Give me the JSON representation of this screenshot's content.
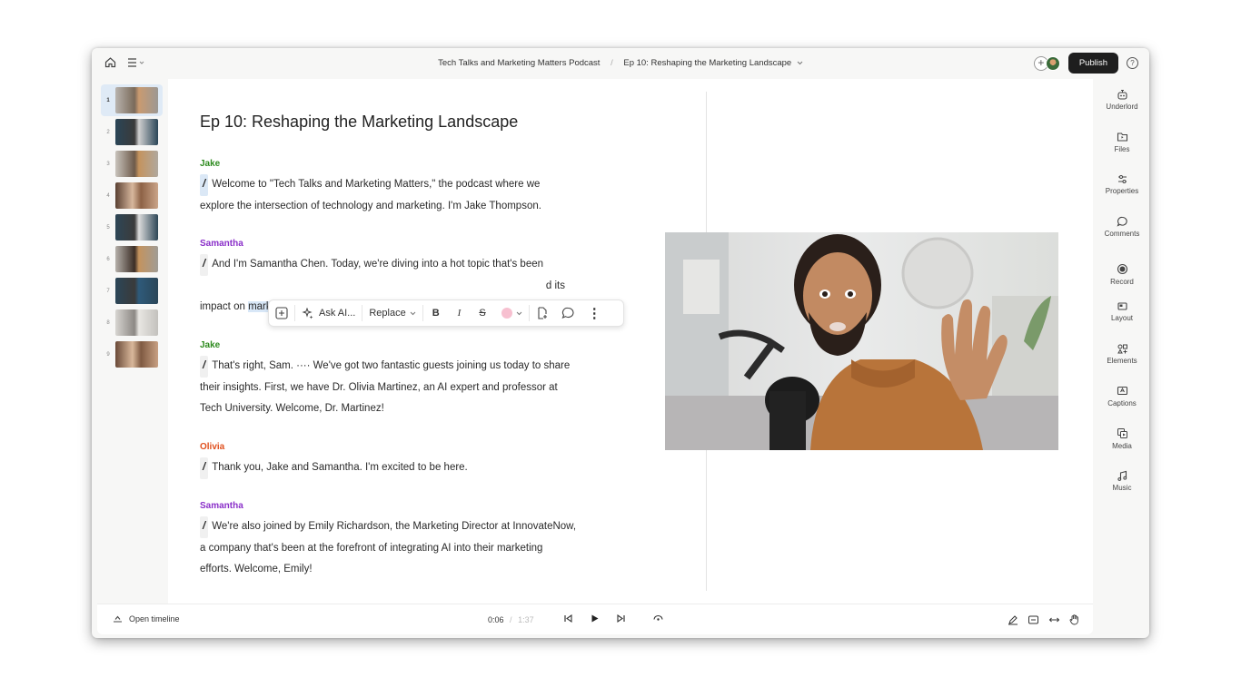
{
  "topbar": {
    "project": "Tech Talks and Marketing Matters Podcast",
    "separator": "/",
    "episode": "Ep 10: Reshaping the Marketing Landscape",
    "publish_label": "Publish",
    "add_label": "+",
    "help_label": "?"
  },
  "thumbnails": [
    {
      "num": "1",
      "bg": "#8f8a86"
    },
    {
      "num": "2",
      "bg": "#2f4a5c"
    },
    {
      "num": "3",
      "bg": "#a79c90"
    },
    {
      "num": "4",
      "bg": "#8c6a58"
    },
    {
      "num": "5",
      "bg": "#2d4656"
    },
    {
      "num": "6",
      "bg": "#9d9890"
    },
    {
      "num": "7",
      "bg": "#2b4658"
    },
    {
      "num": "8",
      "bg": "#c3c1bd"
    },
    {
      "num": "9",
      "bg": "#8b6853"
    }
  ],
  "document": {
    "title": "Ep 10: Reshaping the Marketing Landscape",
    "blocks": [
      {
        "speaker": "Jake",
        "color": "#2e8b1f",
        "text_lines": [
          "Welcome to \"Tech Talks and Marketing Matters,\" the podcast where we",
          "explore the intersection of technology and marketing. I'm Jake Thompson."
        ]
      },
      {
        "speaker": "Samantha",
        "color": "#8a2fc9",
        "line1": "And I'm Samantha Chen. Today, we're diving into a hot topic that's been",
        "line2_tail": "d its",
        "line3_pre": "impact on ",
        "line3_hl": "marketing strategies."
      },
      {
        "speaker": "Jake",
        "color": "#2e8b1f",
        "text_lines": [
          "That's right, Sam. ···· We've got two fantastic guests joining us today to share",
          "their insights. First, we have Dr. Olivia Martinez, an AI expert and professor at",
          "Tech University. Welcome, Dr. Martinez!"
        ]
      },
      {
        "speaker": "Olivia",
        "color": "#e0501e",
        "text_lines": [
          "Thank you, Jake and Samantha. I'm excited to be here."
        ]
      },
      {
        "speaker": "Samantha",
        "color": "#8a2fc9",
        "text_lines": [
          "We're also joined by Emily Richardson, the Marketing Director at InnovateNow,",
          "a company that's been at the forefront of integrating AI into their marketing",
          "efforts. Welcome, Emily!"
        ]
      }
    ],
    "slash": "/"
  },
  "format_toolbar": {
    "ask_ai": "Ask AI...",
    "replace": "Replace",
    "bold": "B",
    "italic": "I",
    "strike": "S",
    "more": "⋮",
    "highlight_color": "#f7c0d0"
  },
  "right_sidebar": [
    {
      "label": "Underlord",
      "icon": "robot-icon"
    },
    {
      "label": "Files",
      "icon": "folder-icon"
    },
    {
      "label": "Properties",
      "icon": "sliders-icon"
    },
    {
      "label": "Comments",
      "icon": "comment-icon"
    },
    {
      "label": "Record",
      "icon": "record-icon"
    },
    {
      "label": "Layout",
      "icon": "layout-icon"
    },
    {
      "label": "Elements",
      "icon": "elements-icon"
    },
    {
      "label": "Captions",
      "icon": "captions-icon"
    },
    {
      "label": "Media",
      "icon": "media-icon"
    },
    {
      "label": "Music",
      "icon": "music-icon"
    }
  ],
  "bottom_bar": {
    "open_timeline": "Open timeline",
    "current_time": "0:06",
    "time_sep": "/",
    "total_time": "1:37"
  },
  "colors": {
    "accent_highlight": "#d8e7f7",
    "publish_bg": "#1e1e1e"
  }
}
